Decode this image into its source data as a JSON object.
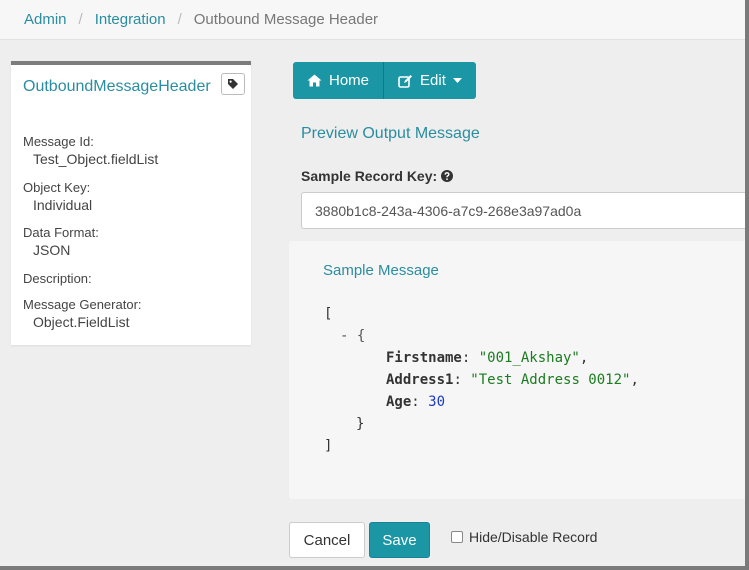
{
  "breadcrumb": {
    "items": [
      "Admin",
      "Integration"
    ],
    "current": "Outbound Message Header",
    "separator": "/"
  },
  "left_panel": {
    "title": "OutboundMessageHeader",
    "tag_icon": "tag-icon",
    "fields": [
      {
        "label": "Message Id:",
        "value": "Test_Object.fieldList"
      },
      {
        "label": "Object Key:",
        "value": "Individual"
      },
      {
        "label": "Data Format:",
        "value": "JSON"
      },
      {
        "label": "Description:",
        "value": ""
      },
      {
        "label": "Message Generator:",
        "value": "Object.FieldList"
      }
    ]
  },
  "toolbar": {
    "home_label": "Home",
    "home_icon": "home-icon",
    "edit_label": "Edit",
    "edit_icon": "edit-icon"
  },
  "preview": {
    "title": "Preview Output Message",
    "key_label": "Sample Record Key:",
    "key_help_icon": "question-circle-icon",
    "key_value": "3880b1c8-243a-4306-a7c9-268e3a97ad0a"
  },
  "sample": {
    "title": "Sample Message",
    "open_bracket": "[",
    "collapse_marker": "- {",
    "entries": [
      {
        "key": "Firstname",
        "value": "\"001_Akshay\"",
        "type": "string",
        "trail": ","
      },
      {
        "key": "Address1",
        "value": "\"Test Address 0012\"",
        "type": "string",
        "trail": ","
      },
      {
        "key": "Age",
        "value": "30",
        "type": "number",
        "trail": ""
      }
    ],
    "close_brace": "}",
    "close_bracket": "]"
  },
  "footer": {
    "cancel_label": "Cancel",
    "save_label": "Save",
    "hide_label": "Hide/Disable Record",
    "hide_checked": false
  },
  "colors": {
    "accent": "#1a96a5",
    "link": "#2a8da0",
    "json_string": "#1b7c20",
    "json_number": "#1a3ac0"
  }
}
